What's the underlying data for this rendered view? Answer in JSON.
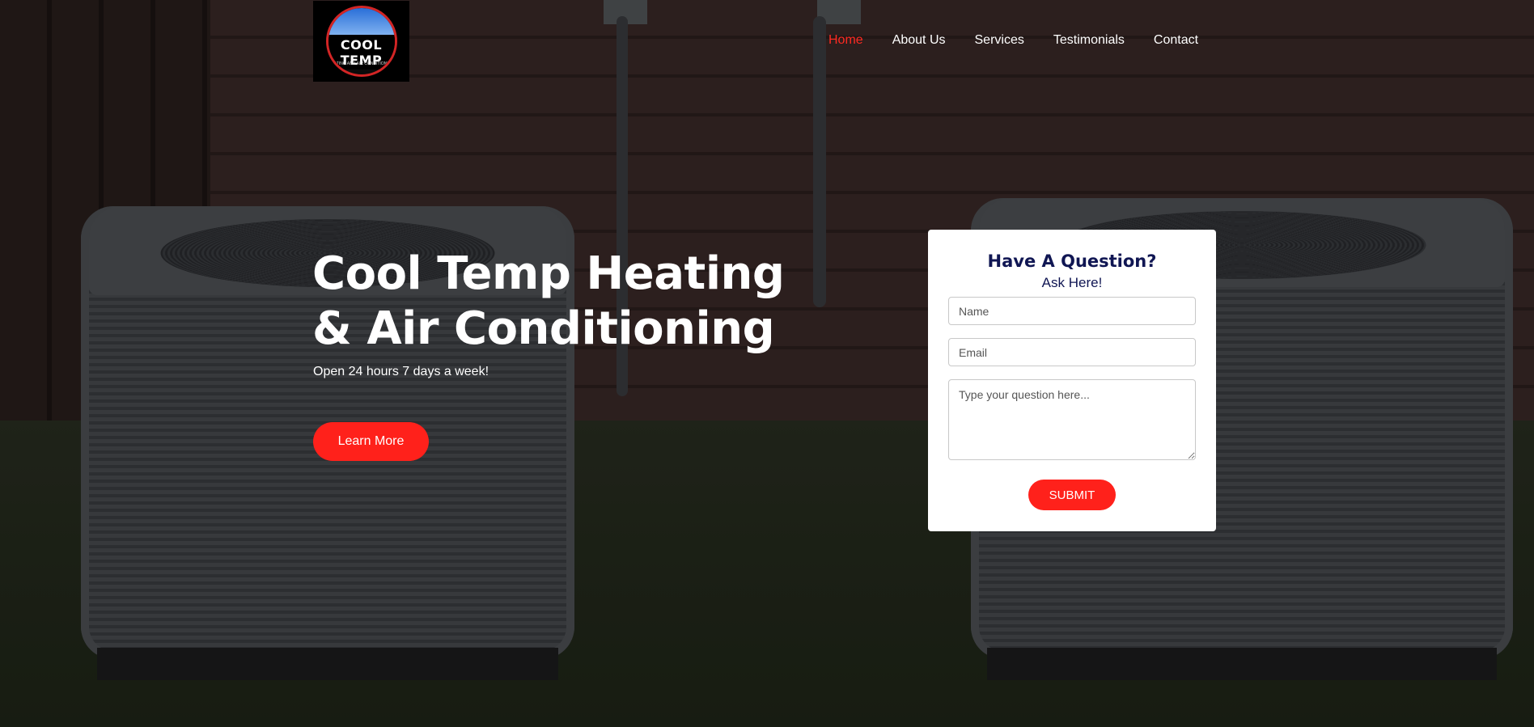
{
  "logo": {
    "name": "COOL TEMP",
    "tagline": "HEATING AND AIR CONDITIONING"
  },
  "nav": {
    "items": [
      "Home",
      "About Us",
      "Services",
      "Testimonials",
      "Contact"
    ],
    "active_index": 0
  },
  "hero": {
    "title_line1": "Cool Temp Heating",
    "title_line2": "& Air Conditioning",
    "subtitle": "Open 24 hours 7 days a week!",
    "cta_label": "Learn More"
  },
  "form": {
    "heading": "Have A Question?",
    "subheading": "Ask Here!",
    "name_placeholder": "Name",
    "email_placeholder": "Email",
    "question_placeholder": "Type your question here...",
    "submit_label": "SUBMIT"
  },
  "colors": {
    "accent": "#ff211b",
    "heading": "#101653"
  },
  "icons": {
    "logo": "cool-temp-logo-badge"
  }
}
